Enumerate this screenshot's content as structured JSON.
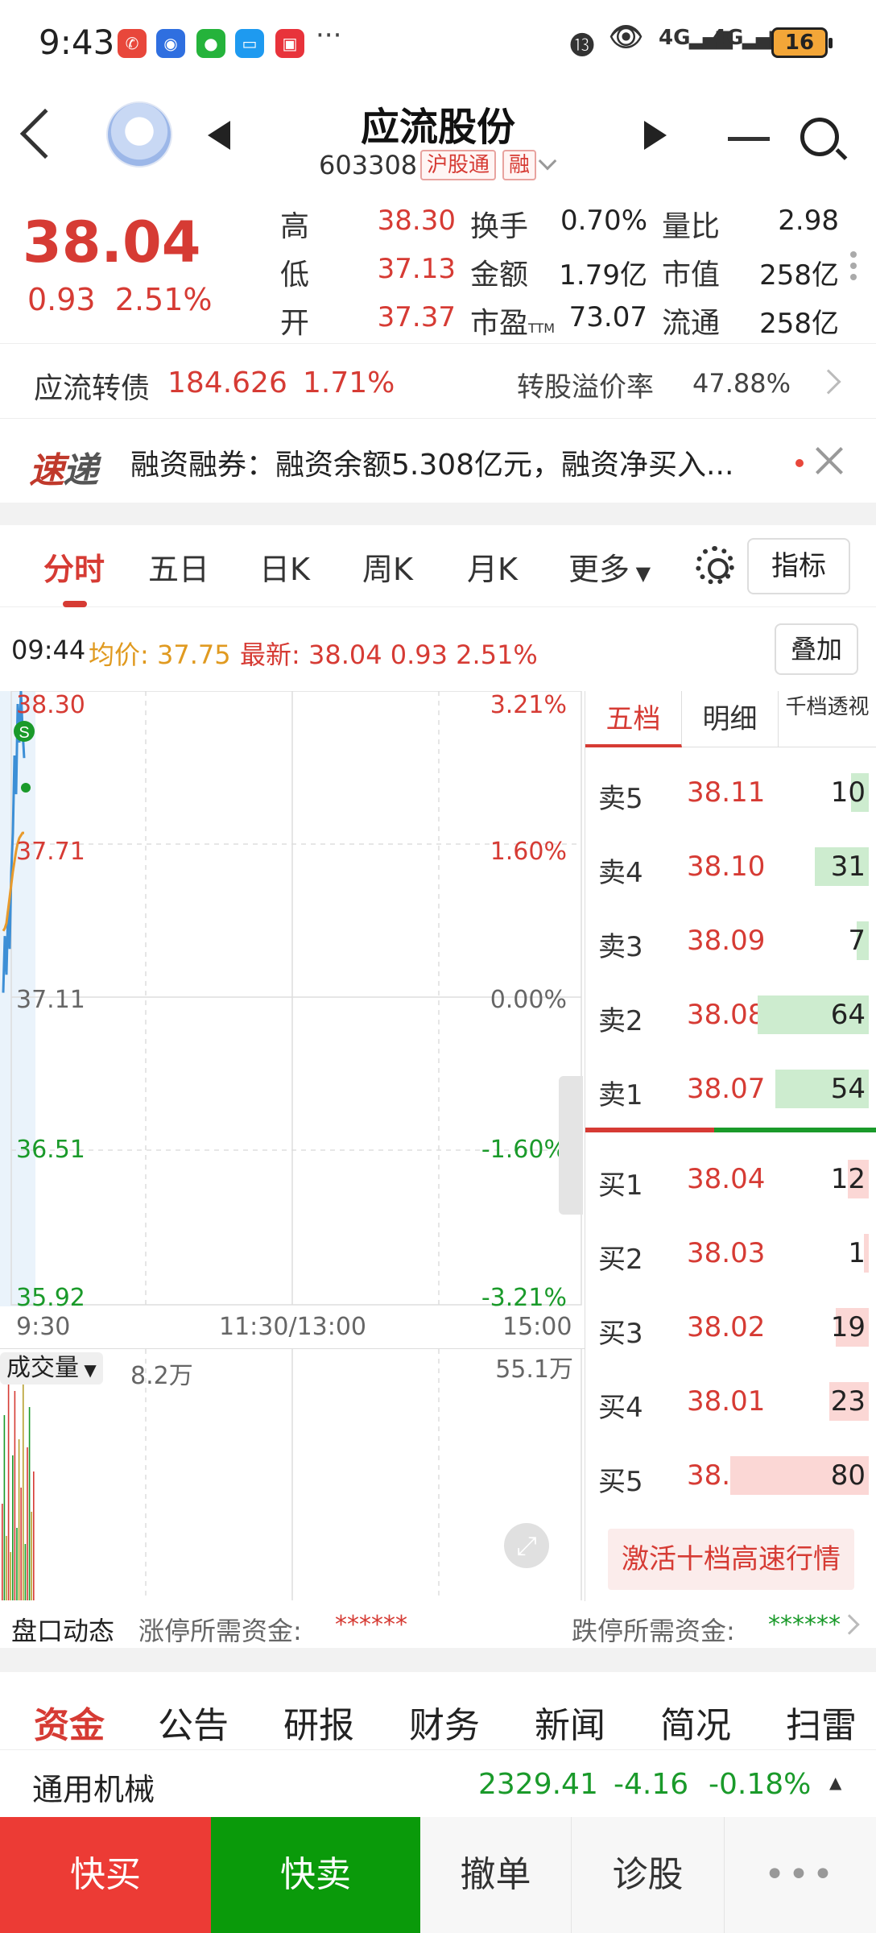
{
  "status_bar": {
    "time": "9:43",
    "battery": "16",
    "signal1": "4G",
    "signal2": "4G",
    "more": "···"
  },
  "header": {
    "name": "应流股份",
    "code": "603308",
    "tag1": "沪股通",
    "tag2": "融"
  },
  "quote": {
    "price": "38.04",
    "change": "0.93",
    "change_pct": "2.51%",
    "labels": {
      "high": "高",
      "low": "低",
      "open": "开",
      "turnover": "换手",
      "amount": "金额",
      "pe": "市盈",
      "pe_sub": "TTM",
      "vol_ratio": "量比",
      "mkt_cap": "市值",
      "float_cap": "流通"
    },
    "values": {
      "high": "38.30",
      "low": "37.13",
      "open": "37.37",
      "turnover": "0.70%",
      "amount": "1.79亿",
      "pe": "73.07",
      "vol_ratio": "2.98",
      "mkt_cap": "258亿",
      "float_cap": "258亿"
    }
  },
  "bond": {
    "name": "应流转债",
    "price": "184.626",
    "pct": "1.71%",
    "premium_label": "转股溢价率",
    "premium": "47.88%"
  },
  "news": {
    "logo_a": "速",
    "logo_b": "递",
    "text": "融资融券：融资余额5.308亿元，融资净买入..."
  },
  "tabs": {
    "items": [
      "分时",
      "五日",
      "日K",
      "周K",
      "月K",
      "更多"
    ],
    "indicator": "指标"
  },
  "info": {
    "time": "09:44",
    "avg_label": "均价:",
    "avg": "37.75",
    "latest_label": "最新:",
    "latest": "38.04 0.93 2.51%",
    "overlay": "叠加"
  },
  "chart": {
    "y_left": [
      "38.30",
      "37.71",
      "37.11",
      "36.51",
      "35.92"
    ],
    "y_right": [
      "3.21%",
      "1.60%",
      "0.00%",
      "-1.60%",
      "-3.21%"
    ],
    "x_labels": [
      "9:30",
      "11:30/13:00",
      "15:00"
    ],
    "marker": "S",
    "vol_selector": "成交量",
    "vol_current": "8.2万",
    "vol_max": "55.1万"
  },
  "chart_data": {
    "type": "line",
    "ylim": [
      35.92,
      38.3
    ],
    "x_range": [
      "9:30",
      "15:00"
    ],
    "series": [
      {
        "values": [
          37.13,
          37.35,
          37.2,
          37.45,
          37.3,
          37.6,
          37.75,
          38.05,
          37.9,
          38.25,
          38.1,
          38.3,
          38.15,
          38.04
        ]
      },
      {
        "values": [
          37.37,
          37.38,
          37.4,
          37.45,
          37.5,
          37.55,
          37.6,
          37.64,
          37.68,
          37.71,
          37.73,
          37.74,
          37.75,
          37.75
        ]
      }
    ]
  },
  "book": {
    "tabs": [
      "五档",
      "明细",
      "千档透视"
    ],
    "asks": [
      {
        "label": "卖5",
        "price": "38.11",
        "vol": 10
      },
      {
        "label": "卖4",
        "price": "38.10",
        "vol": 31
      },
      {
        "label": "卖3",
        "price": "38.09",
        "vol": 7
      },
      {
        "label": "卖2",
        "price": "38.08",
        "vol": 64
      },
      {
        "label": "卖1",
        "price": "38.07",
        "vol": 54
      }
    ],
    "bids": [
      {
        "label": "买1",
        "price": "38.04",
        "vol": 12
      },
      {
        "label": "买2",
        "price": "38.03",
        "vol": 1
      },
      {
        "label": "买3",
        "price": "38.02",
        "vol": 19
      },
      {
        "label": "买4",
        "price": "38.01",
        "vol": 23
      },
      {
        "label": "买5",
        "price": "38.00",
        "vol": 80
      }
    ],
    "activate": "激活十档高速行情"
  },
  "pankou": {
    "title": "盘口动态",
    "limit_up_label": "涨停所需资金:",
    "limit_up_value": "******",
    "limit_down_label": "跌停所需资金:",
    "limit_down_value": "******"
  },
  "fund_tabs": [
    "资金",
    "公告",
    "研报",
    "财务",
    "新闻",
    "简况",
    "扫雷"
  ],
  "industry": {
    "name": "通用机械",
    "value": "2329.41",
    "change": "-4.16",
    "pct": "-0.18%"
  },
  "actions": {
    "buy": "快买",
    "sell": "快卖",
    "cancel": "撤单",
    "diagnose": "诊股"
  },
  "colors": {
    "red": "#d63b34",
    "green": "#1a9a2a",
    "buy_btn": "#ec3b35",
    "sell_btn": "#0a9a0a",
    "price_line": "#3d8fd6",
    "avg_line": "#e89a2c"
  }
}
